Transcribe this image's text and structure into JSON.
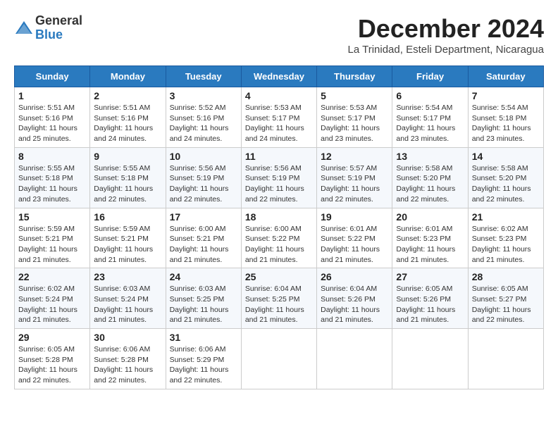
{
  "logo": {
    "general": "General",
    "blue": "Blue"
  },
  "title": "December 2024",
  "subtitle": "La Trinidad, Esteli Department, Nicaragua",
  "weekdays": [
    "Sunday",
    "Monday",
    "Tuesday",
    "Wednesday",
    "Thursday",
    "Friday",
    "Saturday"
  ],
  "weeks": [
    [
      {
        "day": "1",
        "info": "Sunrise: 5:51 AM\nSunset: 5:16 PM\nDaylight: 11 hours\nand 25 minutes."
      },
      {
        "day": "2",
        "info": "Sunrise: 5:51 AM\nSunset: 5:16 PM\nDaylight: 11 hours\nand 24 minutes."
      },
      {
        "day": "3",
        "info": "Sunrise: 5:52 AM\nSunset: 5:16 PM\nDaylight: 11 hours\nand 24 minutes."
      },
      {
        "day": "4",
        "info": "Sunrise: 5:53 AM\nSunset: 5:17 PM\nDaylight: 11 hours\nand 24 minutes."
      },
      {
        "day": "5",
        "info": "Sunrise: 5:53 AM\nSunset: 5:17 PM\nDaylight: 11 hours\nand 23 minutes."
      },
      {
        "day": "6",
        "info": "Sunrise: 5:54 AM\nSunset: 5:17 PM\nDaylight: 11 hours\nand 23 minutes."
      },
      {
        "day": "7",
        "info": "Sunrise: 5:54 AM\nSunset: 5:18 PM\nDaylight: 11 hours\nand 23 minutes."
      }
    ],
    [
      {
        "day": "8",
        "info": "Sunrise: 5:55 AM\nSunset: 5:18 PM\nDaylight: 11 hours\nand 23 minutes."
      },
      {
        "day": "9",
        "info": "Sunrise: 5:55 AM\nSunset: 5:18 PM\nDaylight: 11 hours\nand 22 minutes."
      },
      {
        "day": "10",
        "info": "Sunrise: 5:56 AM\nSunset: 5:19 PM\nDaylight: 11 hours\nand 22 minutes."
      },
      {
        "day": "11",
        "info": "Sunrise: 5:56 AM\nSunset: 5:19 PM\nDaylight: 11 hours\nand 22 minutes."
      },
      {
        "day": "12",
        "info": "Sunrise: 5:57 AM\nSunset: 5:19 PM\nDaylight: 11 hours\nand 22 minutes."
      },
      {
        "day": "13",
        "info": "Sunrise: 5:58 AM\nSunset: 5:20 PM\nDaylight: 11 hours\nand 22 minutes."
      },
      {
        "day": "14",
        "info": "Sunrise: 5:58 AM\nSunset: 5:20 PM\nDaylight: 11 hours\nand 22 minutes."
      }
    ],
    [
      {
        "day": "15",
        "info": "Sunrise: 5:59 AM\nSunset: 5:21 PM\nDaylight: 11 hours\nand 21 minutes."
      },
      {
        "day": "16",
        "info": "Sunrise: 5:59 AM\nSunset: 5:21 PM\nDaylight: 11 hours\nand 21 minutes."
      },
      {
        "day": "17",
        "info": "Sunrise: 6:00 AM\nSunset: 5:21 PM\nDaylight: 11 hours\nand 21 minutes."
      },
      {
        "day": "18",
        "info": "Sunrise: 6:00 AM\nSunset: 5:22 PM\nDaylight: 11 hours\nand 21 minutes."
      },
      {
        "day": "19",
        "info": "Sunrise: 6:01 AM\nSunset: 5:22 PM\nDaylight: 11 hours\nand 21 minutes."
      },
      {
        "day": "20",
        "info": "Sunrise: 6:01 AM\nSunset: 5:23 PM\nDaylight: 11 hours\nand 21 minutes."
      },
      {
        "day": "21",
        "info": "Sunrise: 6:02 AM\nSunset: 5:23 PM\nDaylight: 11 hours\nand 21 minutes."
      }
    ],
    [
      {
        "day": "22",
        "info": "Sunrise: 6:02 AM\nSunset: 5:24 PM\nDaylight: 11 hours\nand 21 minutes."
      },
      {
        "day": "23",
        "info": "Sunrise: 6:03 AM\nSunset: 5:24 PM\nDaylight: 11 hours\nand 21 minutes."
      },
      {
        "day": "24",
        "info": "Sunrise: 6:03 AM\nSunset: 5:25 PM\nDaylight: 11 hours\nand 21 minutes."
      },
      {
        "day": "25",
        "info": "Sunrise: 6:04 AM\nSunset: 5:25 PM\nDaylight: 11 hours\nand 21 minutes."
      },
      {
        "day": "26",
        "info": "Sunrise: 6:04 AM\nSunset: 5:26 PM\nDaylight: 11 hours\nand 21 minutes."
      },
      {
        "day": "27",
        "info": "Sunrise: 6:05 AM\nSunset: 5:26 PM\nDaylight: 11 hours\nand 21 minutes."
      },
      {
        "day": "28",
        "info": "Sunrise: 6:05 AM\nSunset: 5:27 PM\nDaylight: 11 hours\nand 22 minutes."
      }
    ],
    [
      {
        "day": "29",
        "info": "Sunrise: 6:05 AM\nSunset: 5:28 PM\nDaylight: 11 hours\nand 22 minutes."
      },
      {
        "day": "30",
        "info": "Sunrise: 6:06 AM\nSunset: 5:28 PM\nDaylight: 11 hours\nand 22 minutes."
      },
      {
        "day": "31",
        "info": "Sunrise: 6:06 AM\nSunset: 5:29 PM\nDaylight: 11 hours\nand 22 minutes."
      },
      null,
      null,
      null,
      null
    ]
  ]
}
